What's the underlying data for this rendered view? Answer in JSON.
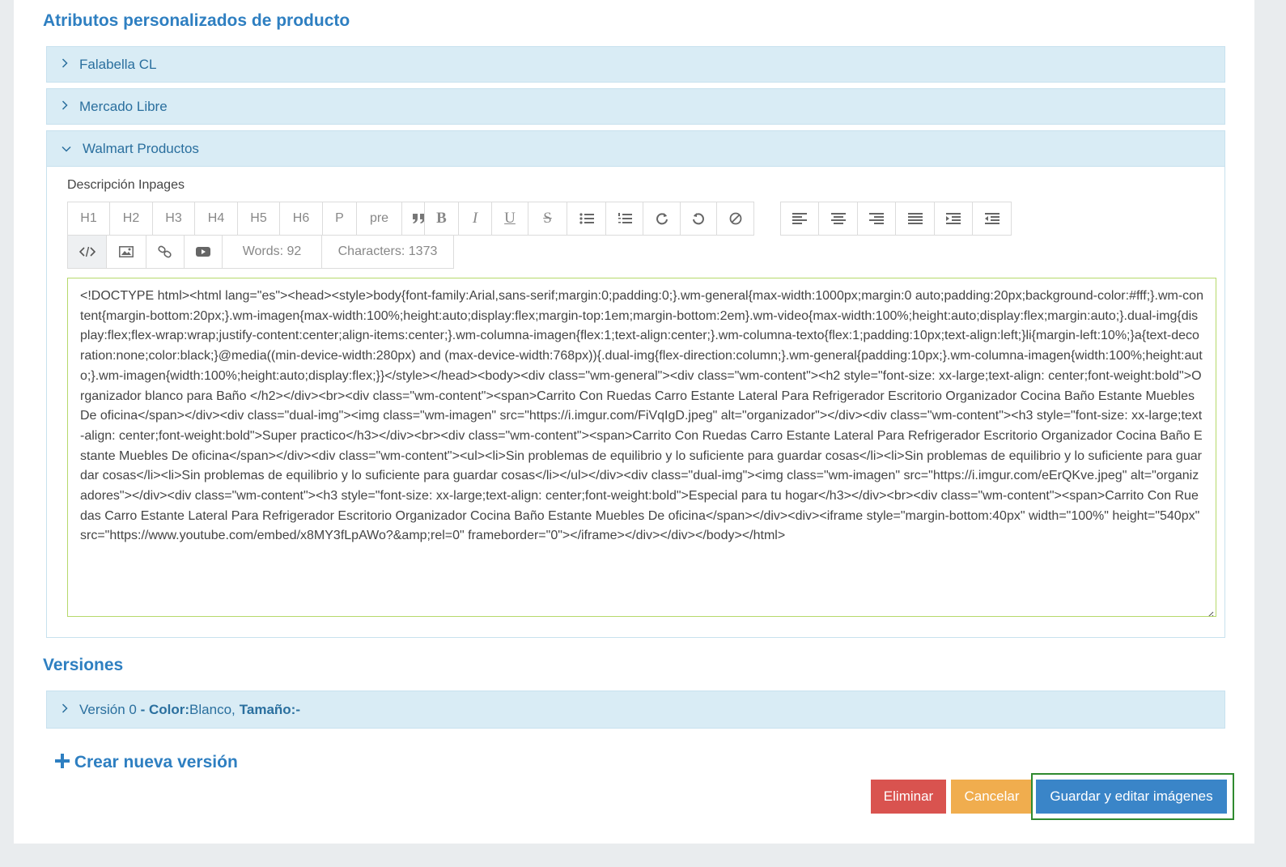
{
  "sections": {
    "custom_attributes_title": "Atributos personalizados de producto",
    "versions_title": "Versiones"
  },
  "accordion": [
    {
      "label": "Falabella CL",
      "expanded": false
    },
    {
      "label": "Mercado Libre",
      "expanded": false
    },
    {
      "label": "Walmart Productos",
      "expanded": true
    }
  ],
  "editor": {
    "label": "Descripción Inpages",
    "toolbar_row1": [
      "H1",
      "H2",
      "H3",
      "H4",
      "H5",
      "H6",
      "P",
      "pre",
      "blockquote-icon",
      "bold-icon",
      "italic-icon",
      "underline-icon",
      "strikethrough-icon",
      "bullet-list-icon",
      "numbered-list-icon",
      "redo-icon",
      "undo-icon",
      "clear-format-icon",
      "align-left-icon",
      "align-center-icon",
      "align-right-icon",
      "align-justify-icon",
      "indent-icon",
      "outdent-icon"
    ],
    "toolbar_row2": [
      "code-view-icon",
      "image-icon",
      "link-icon",
      "video-icon"
    ],
    "words": "Words: 92",
    "characters": "Characters: 1373",
    "content": "<!DOCTYPE html><html lang=\"es\"><head><style>body{font-family:Arial,sans-serif;margin:0;padding:0;}.wm-general{max-width:1000px;margin:0 auto;padding:20px;background-color:#fff;}.wm-content{margin-bottom:20px;}.wm-imagen{max-width:100%;height:auto;display:flex;margin-top:1em;margin-bottom:2em}.wm-video{max-width:100%;height:auto;display:flex;margin:auto;}.dual-img{display:flex;flex-wrap:wrap;justify-content:center;align-items:center;}.wm-columna-imagen{flex:1;text-align:center;}.wm-columna-texto{flex:1;padding:10px;text-align:left;}li{margin-left:10%;}a{text-decoration:none;color:black;}@media((min-device-width:280px) and (max-device-width:768px)){.dual-img{flex-direction:column;}.wm-general{padding:10px;}.wm-columna-imagen{width:100%;height:auto;}.wm-imagen{width:100%;height:auto;display:flex;}}</style></head><body><div class=\"wm-general\"><div class=\"wm-content\"><h2 style=\"font-size: xx-large;text-align: center;font-weight:bold\">Organizador blanco para Baño </h2></div><br><div class=\"wm-content\"><span>Carrito Con Ruedas Carro Estante Lateral Para Refrigerador Escritorio Organizador Cocina Baño Estante Muebles De oficina</span></div><div class=\"dual-img\"><img class=\"wm-imagen\" src=\"https://i.imgur.com/FiVqIgD.jpeg\" alt=\"organizador\"></div><div class=\"wm-content\"><h3 style=\"font-size: xx-large;text-align: center;font-weight:bold\">Super practico</h3></div><br><div class=\"wm-content\"><span>Carrito Con Ruedas Carro Estante Lateral Para Refrigerador Escritorio Organizador Cocina Baño Estante Muebles De oficina</span></div><div class=\"wm-content\"><ul><li>Sin problemas de equilibrio y lo suficiente para guardar cosas</li><li>Sin problemas de equilibrio y lo suficiente para guardar cosas</li><li>Sin problemas de equilibrio y lo suficiente para guardar cosas</li></ul></div><div class=\"dual-img\"><img class=\"wm-imagen\" src=\"https://i.imgur.com/eErQKve.jpeg\" alt=\"organizadores\"></div><div class=\"wm-content\"><h3 style=\"font-size: xx-large;text-align: center;font-weight:bold\">Especial para tu hogar</h3></div><br><div class=\"wm-content\"><span>Carrito Con Ruedas Carro Estante Lateral Para Refrigerador Escritorio Organizador Cocina Baño Estante Muebles De oficina</span></div><div><iframe style=\"margin-bottom:40px\" width=\"100%\" height=\"540px\" src=\"https://www.youtube.com/embed/x8MY3fLpAWo?&amp;rel=0\" frameborder=\"0\"></iframe></div></div></body></html>"
  },
  "version": {
    "prefix": "Versión 0",
    "dash": " - ",
    "color_label": "Color:",
    "color_value": "Blanco,",
    "size_label": "Tamaño:",
    "size_value": "-"
  },
  "add_version_label": "Crear nueva versión",
  "actions": {
    "delete": "Eliminar",
    "cancel": "Cancelar",
    "save": "Guardar y editar imágenes"
  },
  "colors": {
    "title_blue": "#2e7fc1",
    "accordion_bg": "#d9ecf5",
    "delete_red": "#d9534f",
    "cancel_orange": "#f0ad4e",
    "save_blue": "#3a85c8",
    "focus_green": "#2f8a2f"
  }
}
